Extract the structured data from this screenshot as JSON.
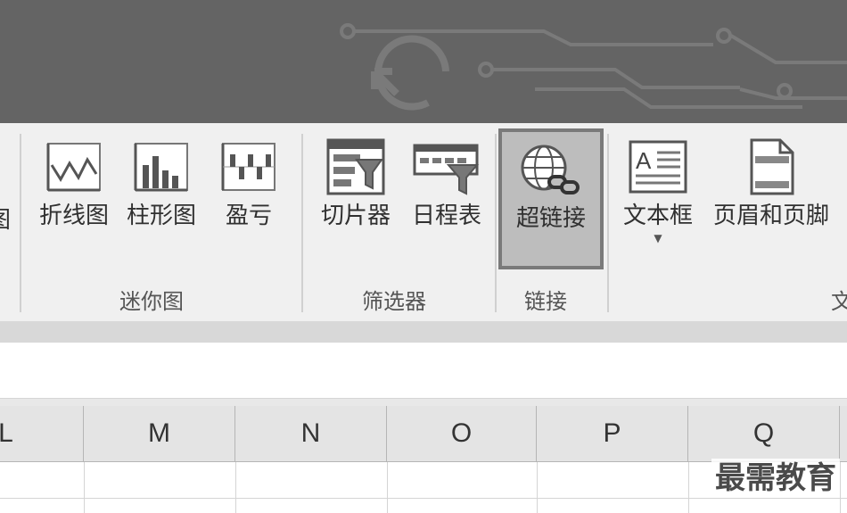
{
  "ribbon": {
    "sparklines": {
      "group_label": "迷你图",
      "line_label": "折线图",
      "column_label": "柱形图",
      "winloss_label": "盈亏"
    },
    "filters": {
      "group_label": "筛选器",
      "slicer_label": "切片器",
      "timeline_label": "日程表"
    },
    "links": {
      "group_label": "链接",
      "hyperlink_label": "超链接"
    },
    "text": {
      "group_label_partial": "文",
      "textbox_label": "文本框",
      "header_footer_label": "页眉和页脚"
    }
  },
  "column_headers": [
    "L",
    "M",
    "N",
    "O",
    "P",
    "Q"
  ],
  "watermark": "最需教育",
  "colors": {
    "banner": "#646464",
    "ribbon_bg": "#f0f0f0",
    "active_button_bg": "#bdbdbd",
    "header_bg": "#e4e4e4"
  },
  "icons": {
    "line": "line-sparkline-icon",
    "column": "column-sparkline-icon",
    "winloss": "winloss-sparkline-icon",
    "slicer": "slicer-icon",
    "timeline": "timeline-icon",
    "hyperlink": "hyperlink-globe-icon",
    "textbox": "textbox-icon",
    "header_footer": "header-footer-icon"
  }
}
